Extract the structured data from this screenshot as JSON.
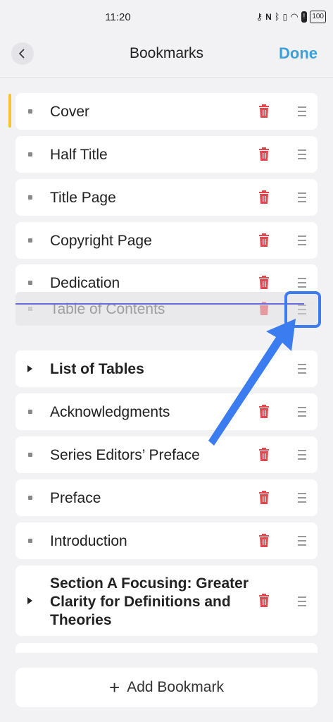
{
  "status_bar": {
    "time": "11:20",
    "battery": "100",
    "icons": [
      "key-icon",
      "nfc-icon",
      "bluetooth-icon",
      "vibrate-icon",
      "wifi-icon",
      "alert-icon",
      "battery-icon"
    ]
  },
  "header": {
    "title": "Bookmarks",
    "done_label": "Done"
  },
  "bookmarks": [
    {
      "label": "Cover",
      "expandable": false,
      "bold": false
    },
    {
      "label": "Half Title",
      "expandable": false,
      "bold": false
    },
    {
      "label": "Title Page",
      "expandable": false,
      "bold": false
    },
    {
      "label": "Copyright Page",
      "expandable": false,
      "bold": false
    },
    {
      "label": "Dedication",
      "expandable": false,
      "bold": false
    },
    {
      "label": "List of Tables",
      "expandable": true,
      "bold": true
    },
    {
      "label": "Acknowledgments",
      "expandable": false,
      "bold": false
    },
    {
      "label": "Series Editors’ Preface",
      "expandable": false,
      "bold": false
    },
    {
      "label": "Preface",
      "expandable": false,
      "bold": false
    },
    {
      "label": "Introduction",
      "expandable": false,
      "bold": false
    },
    {
      "label": "Section A Focusing: Greater Clarity for Definitions and Theories",
      "expandable": true,
      "bold": true
    }
  ],
  "dragging_item": {
    "label": "Table of Contents"
  },
  "footer": {
    "add_label": "Add Bookmark"
  },
  "colors": {
    "accent": "#3aa0dc",
    "trash": "#e0484f",
    "active_marker": "#f4c431",
    "drop_line": "#6b6be0",
    "annotation": "#3b7cf0"
  }
}
